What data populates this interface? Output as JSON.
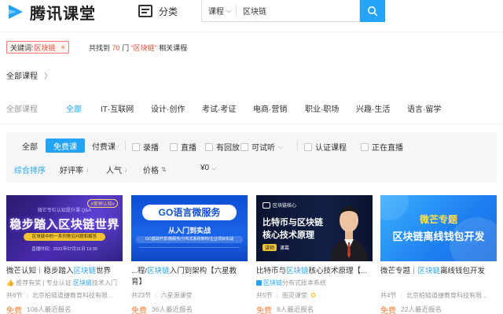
{
  "header": {
    "logo_text": "腾讯课堂",
    "category_label": "分类",
    "search_scope": "课程",
    "search_value": "区块链"
  },
  "keyword": {
    "label": "关键词:",
    "value": "区块链",
    "close": "×"
  },
  "result": {
    "prefix": "共找到",
    "count": "70",
    "unit": "门",
    "query": "“区块链”",
    "suffix": "相关课程"
  },
  "breadcrumb": {
    "label": "全部课程"
  },
  "categories": {
    "label": "全部课程",
    "items": [
      "全部",
      "IT·互联网",
      "设计·创作",
      "考试·考证",
      "电商·营销",
      "职业·职场",
      "兴趣·生活",
      "语言·留学"
    ],
    "active_index": 0
  },
  "filters": {
    "price_tabs": [
      "全部",
      "免费课",
      "付费课"
    ],
    "active_price": 1,
    "checkboxes": [
      "录播",
      "直播",
      "有回放",
      "可试听",
      "认证课程",
      "正在直播"
    ],
    "sort": [
      "综合排序",
      "好评率",
      "人气",
      "价格",
      "¥0"
    ]
  },
  "courses": [
    {
      "thumb_title": "稳步踏入区块链世界",
      "thumb_tag": "#营销认知#",
      "thumb_small": "微芒专栏认知提升课 Q&A",
      "thumb_note": "区块链中的一系列常见问题和解答",
      "thumb_date": "直播时间：2021年07月31日 19:30",
      "title_pre": "微芒认知｜稳步踏入",
      "title_hl": "区块链",
      "title_post": "世界",
      "sub_pre": "推荐有奖 | 专业认证:",
      "sub_hl": "区块链",
      "sub_post": "技术入门",
      "lessons": "共6节",
      "org": "北京柏链道捷教育科技有限...",
      "price": "免费",
      "enrolled": "106人最近报名"
    },
    {
      "thumb_title": "GO语言微服务",
      "thumb_sub": "从入门到实战",
      "thumb_note": "GO基础开发/微服务/分布式系统架构/企业项目实战",
      "title_pre": "...程/",
      "title_hl": "区块链",
      "title_post": "入门到架构【六星教育】",
      "lessons": "共23节",
      "org": "六星源课堂",
      "price": "免费",
      "enrolled": "36人最近报名"
    },
    {
      "thumb_tag": "区块链核心",
      "thumb_title1": "比特币与区块链",
      "thumb_title2": "核心技术原理",
      "thumb_lecturer": "讲师",
      "thumb_name": "诸葛",
      "title_pre": "比特币与",
      "title_hl": "区块链",
      "title_post": "核心技术原理【...",
      "sub_hl": "区块链",
      "sub_post": "分布式账本系统",
      "lessons": "共5节",
      "org": "图灵课堂",
      "price": "免费",
      "enrolled": "9人最近报名"
    },
    {
      "thumb_title1": "微芒专题",
      "thumb_title2": "区块链离线钱包开发",
      "title_pre": "微芒专题｜",
      "title_hl": "区块链",
      "title_post": "离线钱包开发",
      "lessons": "共4节",
      "org": "北京柏链道捷教育科技有限...",
      "price": "免费",
      "enrolled": "22人最近报名"
    }
  ],
  "colors": {
    "accent": "#23a4f9",
    "keyword_red": "#f24c35",
    "free_orange": "#f7813a"
  }
}
